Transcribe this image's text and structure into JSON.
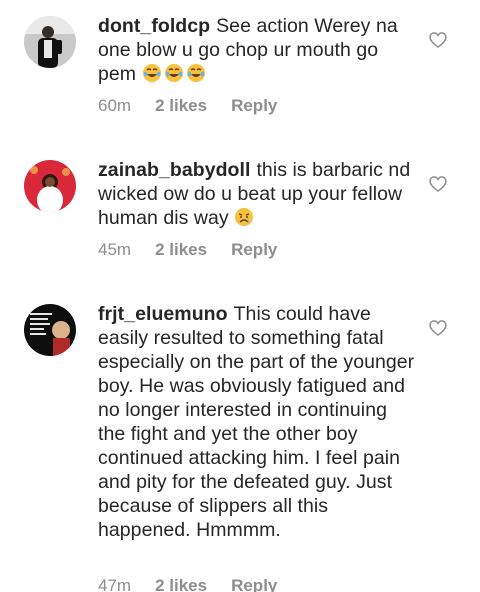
{
  "comments": [
    {
      "username": "dont_foldcp",
      "text": "See action Werey na one blow u go chop ur mouth go pem",
      "emoji": "😂😂😂",
      "time": "60m",
      "likes": "2 likes",
      "reply": "Reply",
      "avatar_icon": "user-avatar-icon",
      "heart_icon": "heart-outline-icon"
    },
    {
      "username": "zainab_babydoll",
      "text": "this is barbaric nd wicked ow do u beat up your fellow human dis way",
      "emoji": "😢",
      "time": "45m",
      "likes": "2 likes",
      "reply": "Reply",
      "avatar_icon": "user-avatar-icon",
      "heart_icon": "heart-outline-icon"
    },
    {
      "username": "frjt_eluemuno",
      "text": "This could have easily resulted to something fatal especially on the part of the younger boy. He was obviously fatigued and no longer interested in continuing the fight and yet the other boy continued attacking him. I feel pain and pity for the defeated guy. Just because of slippers all this happened. Hmmmm.",
      "emoji": "",
      "time": "47m",
      "likes": "2 likes",
      "reply": "Reply",
      "avatar_icon": "user-avatar-icon",
      "heart_icon": "heart-outline-icon"
    }
  ],
  "colors": {
    "text": "#262626",
    "meta": "#8e8e8e",
    "heart_stroke": "#8e8e8e",
    "emoji_face": "#f7c23b"
  }
}
